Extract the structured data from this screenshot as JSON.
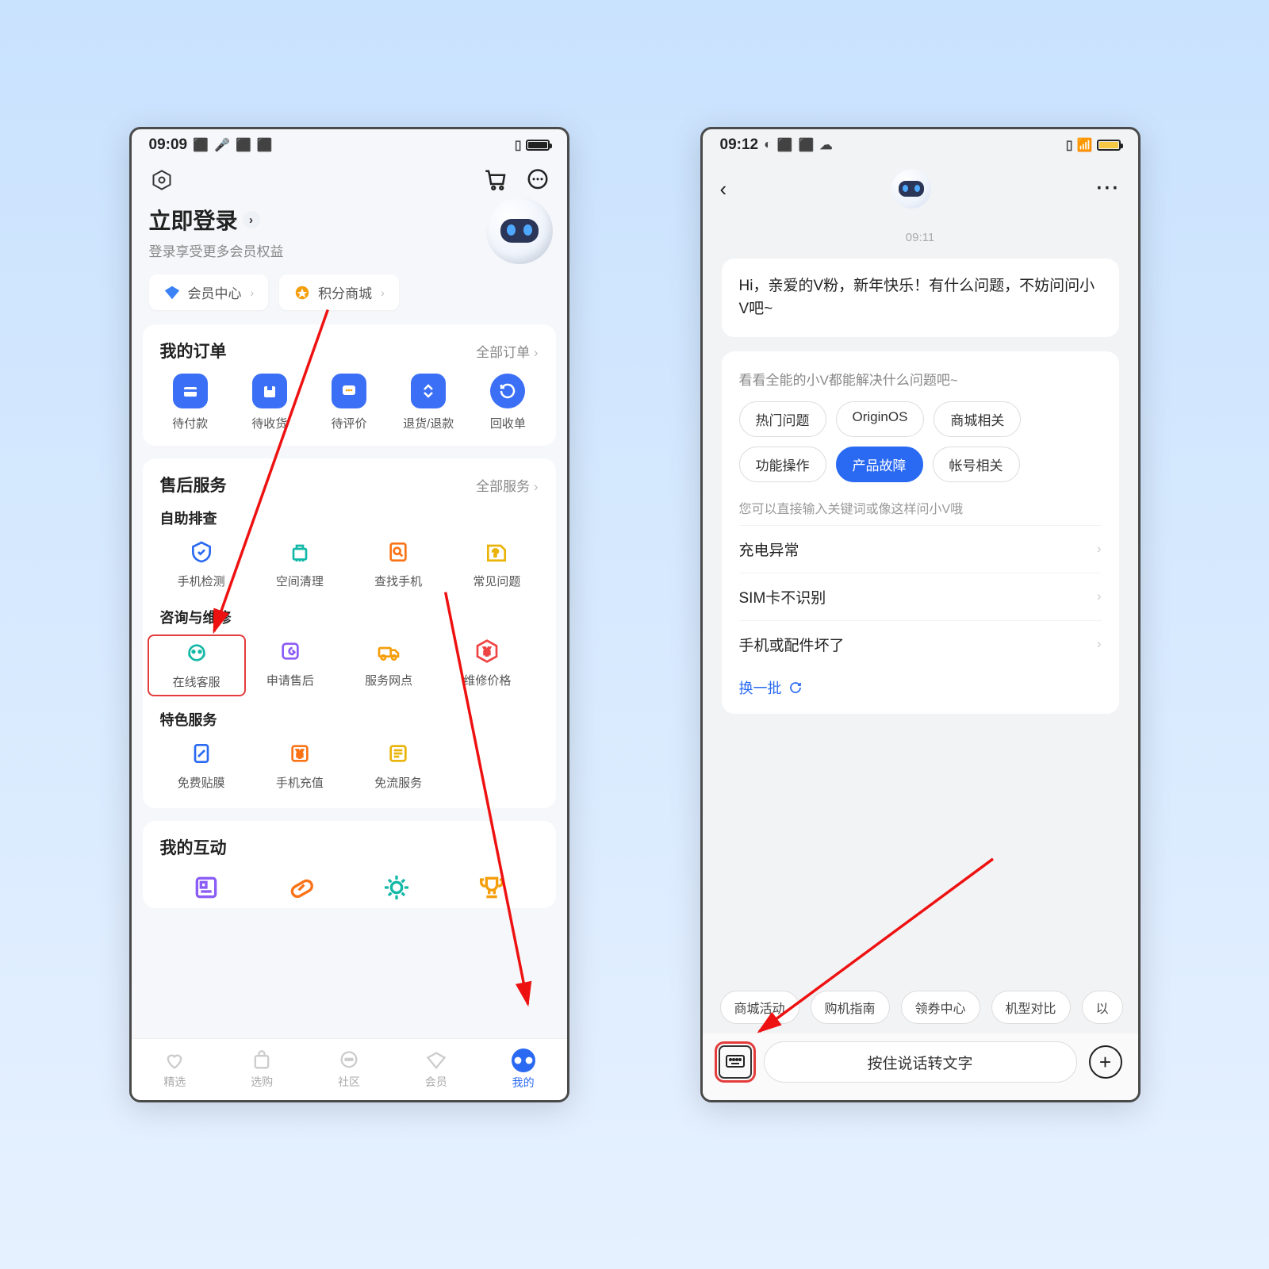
{
  "left": {
    "status": {
      "time": "09:09"
    },
    "login": {
      "title": "立即登录",
      "subtitle": "登录享受更多会员权益"
    },
    "chips": {
      "member": "会员中心",
      "points": "积分商城"
    },
    "orders": {
      "title": "我的订单",
      "all": "全部订单",
      "items": [
        "待付款",
        "待收货",
        "待评价",
        "退货/退款",
        "回收单"
      ]
    },
    "service": {
      "title": "售后服务",
      "all": "全部服务",
      "g1title": "自助排查",
      "g1": [
        "手机检测",
        "空间清理",
        "查找手机",
        "常见问题"
      ],
      "g2title": "咨询与维修",
      "g2": [
        "在线客服",
        "申请售后",
        "服务网点",
        "维修价格"
      ],
      "g3title": "特色服务",
      "g3": [
        "免费贴膜",
        "手机充值",
        "免流服务"
      ]
    },
    "interact": {
      "title": "我的互动"
    },
    "tabs": [
      "精选",
      "选购",
      "社区",
      "会员",
      "我的"
    ]
  },
  "right": {
    "status": {
      "time": "09:12"
    },
    "timestamp": "09:11",
    "greeting": "Hi，亲爱的V粉，新年快乐！有什么问题，不妨问问小V吧~",
    "card": {
      "top": "看看全能的小V都能解决什么问题吧~",
      "pills": [
        "热门问题",
        "OriginOS",
        "商城相关",
        "功能操作",
        "产品故障",
        "帐号相关"
      ],
      "activePill": 4,
      "sub": "您可以直接输入关键词或像这样问小V哦",
      "rows": [
        "充电异常",
        "SIM卡不识别",
        "手机或配件坏了"
      ],
      "refresh": "换一批"
    },
    "bottomChips": [
      "商城活动",
      "购机指南",
      "领券中心",
      "机型对比",
      "以"
    ],
    "inputPlaceholder": "按住说话转文字"
  }
}
